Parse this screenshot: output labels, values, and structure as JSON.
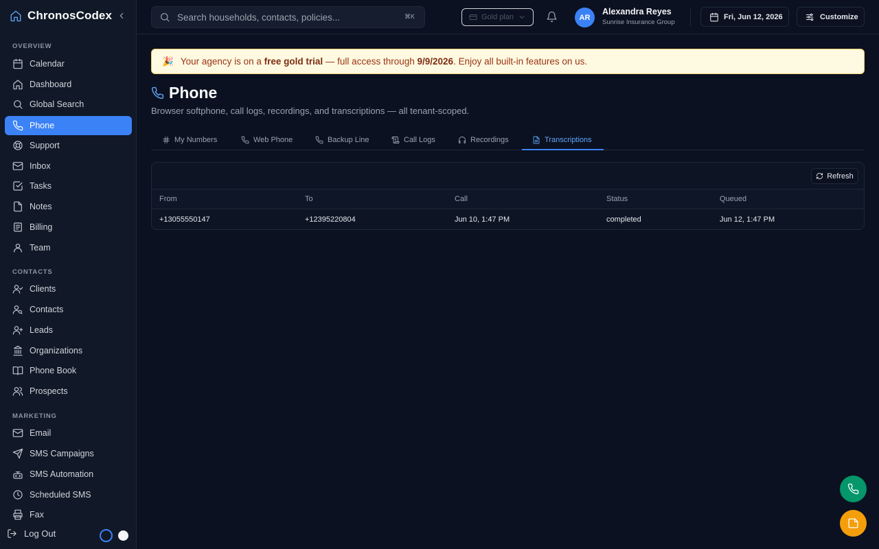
{
  "app": {
    "name": "ChronosCodex"
  },
  "sidebar": {
    "sections": {
      "overview": "OVERVIEW",
      "contacts": "CONTACTS",
      "marketing": "MARKETING"
    },
    "items": [
      {
        "label": "Calendar",
        "icon": "calendar-icon"
      },
      {
        "label": "Dashboard",
        "icon": "home-icon"
      },
      {
        "label": "Global Search",
        "icon": "search-icon"
      },
      {
        "label": "Phone",
        "icon": "phone-icon",
        "active": true
      },
      {
        "label": "Support",
        "icon": "lifebuoy-icon"
      },
      {
        "label": "Inbox",
        "icon": "mail-icon"
      },
      {
        "label": "Tasks",
        "icon": "check-square-icon"
      },
      {
        "label": "Notes",
        "icon": "file-icon"
      },
      {
        "label": "Billing",
        "icon": "billing-icon"
      },
      {
        "label": "Team",
        "icon": "user-icon"
      },
      {
        "label": "Clients",
        "icon": "user-check-icon"
      },
      {
        "label": "Contacts",
        "icon": "user-search-icon"
      },
      {
        "label": "Leads",
        "icon": "user-plus-icon"
      },
      {
        "label": "Organizations",
        "icon": "landmark-icon"
      },
      {
        "label": "Phone Book",
        "icon": "book-icon"
      },
      {
        "label": "Prospects",
        "icon": "users-icon"
      },
      {
        "label": "Email",
        "icon": "mail-icon"
      },
      {
        "label": "SMS Campaigns",
        "icon": "send-icon"
      },
      {
        "label": "SMS Automation",
        "icon": "bot-icon"
      },
      {
        "label": "Scheduled SMS",
        "icon": "clock-icon"
      },
      {
        "label": "Fax",
        "icon": "printer-icon"
      }
    ],
    "logout_label": "Log Out"
  },
  "topbar": {
    "search_placeholder": "Search households, contacts, policies...",
    "search_shortcut": "⌘K",
    "plan_label": "Gold plan",
    "user": {
      "initials": "AR",
      "name": "Alexandra Reyes",
      "org": "Sunrise Insurance Group"
    },
    "date_label": "Fri, Jun 12, 2026",
    "customize_label": "Customize"
  },
  "banner": {
    "emoji": "🎉",
    "text_1": "Your agency is on a ",
    "bold_1": "free gold trial",
    "text_2": " — full access through ",
    "bold_2": "9/9/2026",
    "text_3": ". Enjoy all built-in features on us."
  },
  "page": {
    "title": "Phone",
    "subtitle": "Browser softphone, call logs, recordings, and transcriptions — all tenant-scoped."
  },
  "tabs": [
    {
      "label": "My Numbers",
      "icon": "hash-icon"
    },
    {
      "label": "Web Phone",
      "icon": "phone-icon"
    },
    {
      "label": "Backup Line",
      "icon": "phone-icon"
    },
    {
      "label": "Call Logs",
      "icon": "scroll-icon"
    },
    {
      "label": "Recordings",
      "icon": "headphones-icon"
    },
    {
      "label": "Transcriptions",
      "icon": "file-text-icon",
      "active": true
    }
  ],
  "table": {
    "refresh_label": "Refresh",
    "columns": [
      "From",
      "To",
      "Call",
      "Status",
      "Queued"
    ],
    "rows": [
      [
        "+13055550147",
        "+12395220804",
        "Jun 10, 1:47 PM",
        "completed",
        "Jun 12, 1:47 PM"
      ]
    ]
  },
  "colors": {
    "accent": "#3b82f6",
    "background": "#0b1120",
    "sidebar": "#111827",
    "banner_bg": "#fef9e1",
    "fab_phone": "#059669",
    "fab_note": "#f59e0b"
  }
}
